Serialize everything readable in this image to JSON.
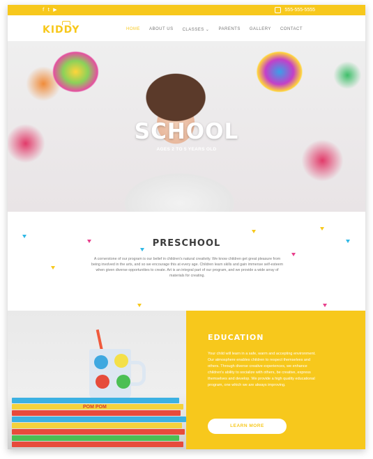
{
  "topbar": {
    "social_icons": [
      "facebook-icon",
      "twitter-icon",
      "youtube-icon"
    ],
    "social_glyphs": [
      "f",
      "t",
      "▶"
    ],
    "phone": "555-555-5555",
    "color": "#f7c81c"
  },
  "nav": {
    "logo": "KIDDY",
    "items": [
      {
        "label": "HOME",
        "active": true
      },
      {
        "label": "ABOUT US"
      },
      {
        "label": "CLASSES ⌄"
      },
      {
        "label": "PARENTS"
      },
      {
        "label": "GALLERY"
      },
      {
        "label": "CONTACT"
      }
    ]
  },
  "hero": {
    "title": "SCHOOL",
    "subtitle": "AGES 2 TO 5 YEARS OLD"
  },
  "preschool": {
    "title": "PRESCHOOL",
    "text": "A cornerstone of our program is our belief in children's natural creativity. We know children get great pleasure from being involved in the arts, and so we encourage this at every age. Children learn skills and gain immense self-esteem when given diverse opportunities to create. Art is an integral part of our program, and we provide a wide array of materials for creating.",
    "triangle_colors": [
      "#2fb8e6",
      "#f7c81c",
      "#e83f8c",
      "#2fb8e6",
      "#f7c81c",
      "#e83f8c",
      "#f7c81c",
      "#2fb8e6",
      "#e83f8c",
      "#f7c81c"
    ]
  },
  "education": {
    "title": "EDUCATION",
    "text": "Your child will learn in a safe, warm and accepting environment. Our atmosphere enables children to respect themselves and others. Through diverse creative experiences, we enhance children's ability to socialize with others, be creative, express themselves and develop. We provide a high quality educational program, one which we are always improving.",
    "button": "LEARN MORE",
    "book_label": "POM POM"
  }
}
